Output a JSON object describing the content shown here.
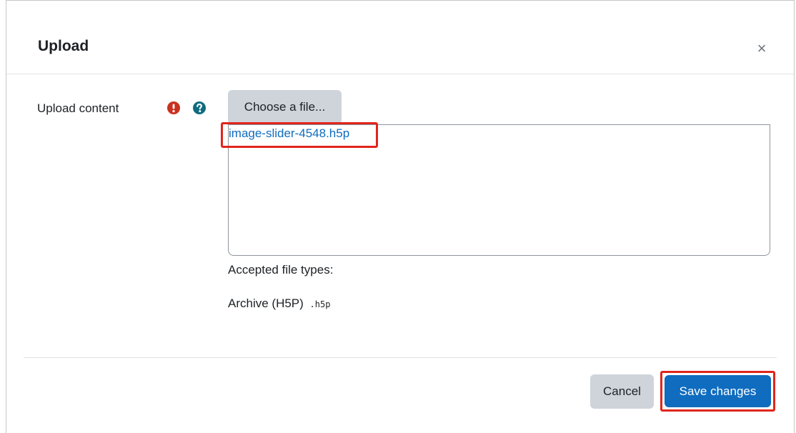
{
  "dialog": {
    "title": "Upload",
    "close_label": "×"
  },
  "form": {
    "field_label": "Upload content",
    "required_icon": "exclamation-circle-icon",
    "help_icon": "question-circle-icon",
    "choose_button_label": "Choose a file...",
    "selected_file": "image-slider-4548.h5p",
    "accepted_label": "Accepted file types:",
    "accepted_type_name": "Archive (H5P)",
    "accepted_type_ext": ".h5p"
  },
  "footer": {
    "cancel_label": "Cancel",
    "save_label": "Save changes"
  },
  "colors": {
    "primary": "#0f6cbf",
    "required": "#ca3120",
    "help": "#0f6b7f",
    "highlight": "#e1251b",
    "secondary_button": "#ced4da"
  }
}
